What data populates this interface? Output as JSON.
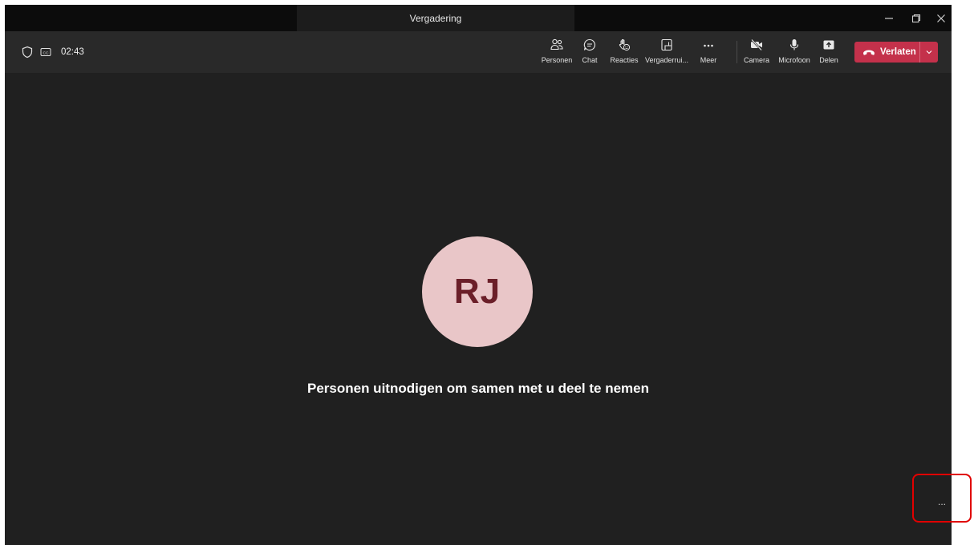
{
  "window": {
    "title": "Vergadering"
  },
  "toolbar": {
    "timer": "02:43",
    "buttons": {
      "people": "Personen",
      "chat": "Chat",
      "reactions": "Reacties",
      "rooms": "Vergaderrui...",
      "more": "Meer",
      "camera": "Camera",
      "microphone": "Microfoon",
      "share": "Delen"
    },
    "leave_label": "Verlaten"
  },
  "stage": {
    "avatar_initials": "RJ",
    "invite_text": "Personen uitnodigen om samen met u deel te nemen",
    "more_options": "..."
  },
  "colors": {
    "leave_button": "#c4314b",
    "avatar_bg": "#e9c6c8",
    "avatar_text": "#6b1f29",
    "highlight": "#e00000"
  }
}
